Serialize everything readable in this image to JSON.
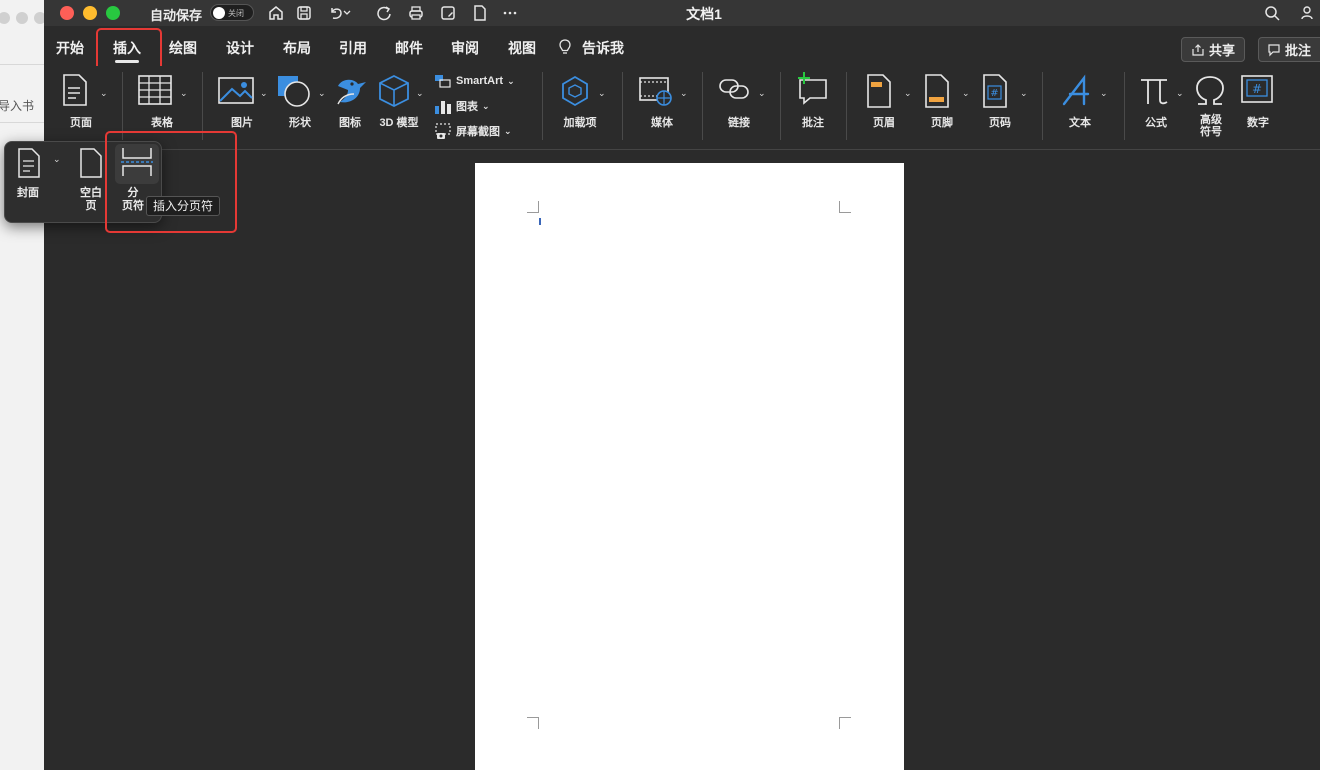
{
  "background_window": {
    "label": "导入书"
  },
  "titlebar": {
    "autosave_label": "自动保存",
    "autosave_state": "关闭",
    "document_title": "文档1"
  },
  "tabs": [
    {
      "label": "开始"
    },
    {
      "label": "插入"
    },
    {
      "label": "绘图"
    },
    {
      "label": "设计"
    },
    {
      "label": "布局"
    },
    {
      "label": "引用"
    },
    {
      "label": "邮件"
    },
    {
      "label": "审阅"
    },
    {
      "label": "视图"
    },
    {
      "label": "告诉我"
    }
  ],
  "actions": {
    "share_label": "共享",
    "comment_label": "批注"
  },
  "ribbon": {
    "page": "页面",
    "table": "表格",
    "picture": "图片",
    "shapes": "形状",
    "icons": "图标",
    "model3d": "3D 模型",
    "smartart": "SmartArt",
    "chart": "图表",
    "screenshot": "屏幕截图",
    "addins": "加载项",
    "media": "媒体",
    "link": "链接",
    "comment": "批注",
    "header": "页眉",
    "footer": "页脚",
    "page_number": "页码",
    "text": "文本",
    "equation": "公式",
    "symbol_line1": "高级",
    "symbol_line2": "符号",
    "number": "数字"
  },
  "popup": {
    "cover": "封面",
    "blank_line1": "空白",
    "blank_line2": "页",
    "break_line1": "分",
    "break_line2": "页符",
    "tooltip": "插入分页符"
  },
  "colors": {
    "highlight": "#e53935",
    "accent_blue": "#3b8ee0",
    "accent_orange": "#f0a340"
  }
}
